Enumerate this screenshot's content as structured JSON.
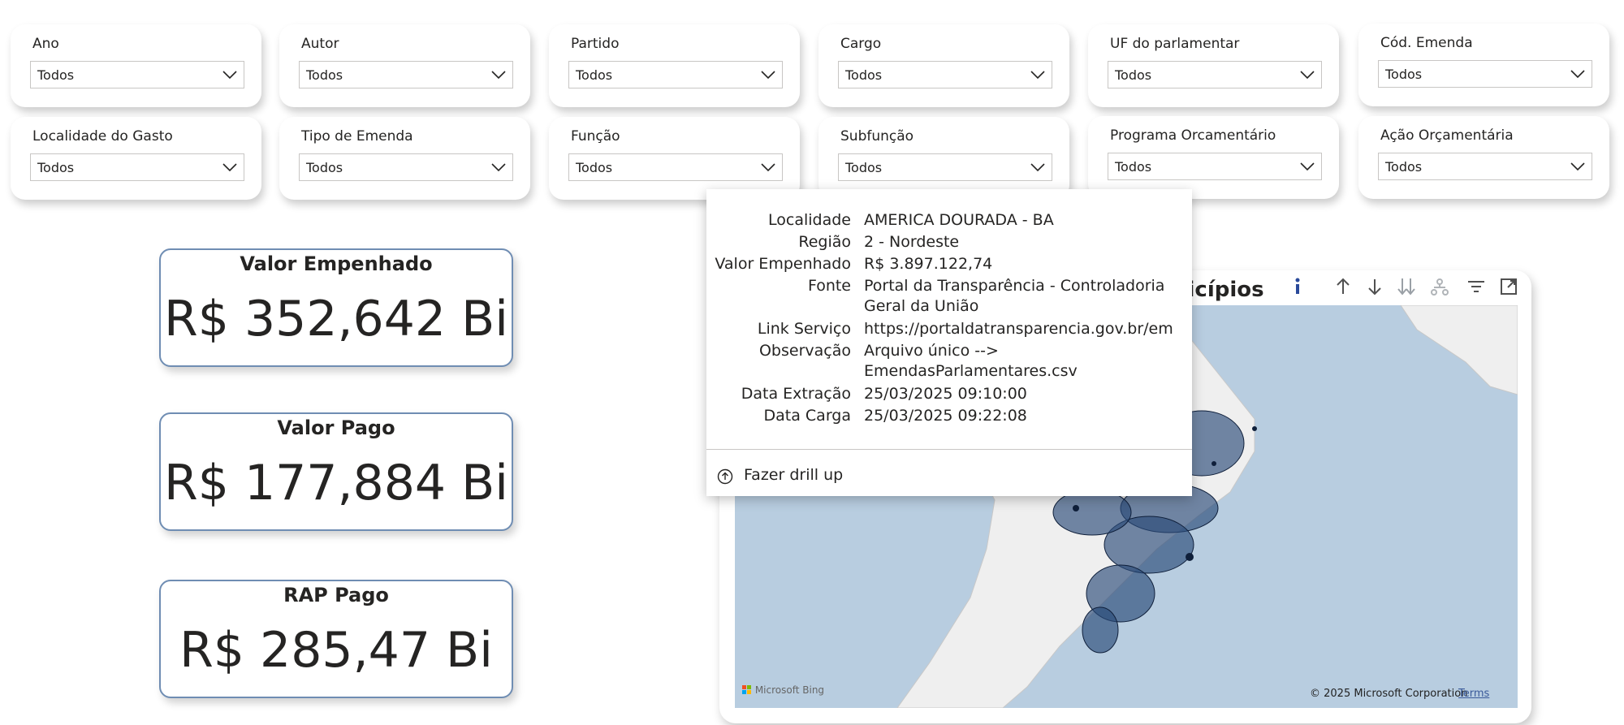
{
  "filters": [
    {
      "label": "Ano",
      "value": "Todos"
    },
    {
      "label": "Autor",
      "value": "Todos"
    },
    {
      "label": "Partido",
      "value": "Todos"
    },
    {
      "label": "Cargo",
      "value": "Todos"
    },
    {
      "label": "UF do parlamentar",
      "value": "Todos"
    },
    {
      "label": "Cód. Emenda",
      "value": "Todos"
    },
    {
      "label": "Localidade do Gasto",
      "value": "Todos"
    },
    {
      "label": "Tipo de Emenda",
      "value": "Todos"
    },
    {
      "label": "Função",
      "value": "Todos"
    },
    {
      "label": "Subfunção",
      "value": "Todos"
    },
    {
      "label": "Programa Orcamentário",
      "value": "Todos"
    },
    {
      "label": "Ação Orçamentária",
      "value": "Todos"
    }
  ],
  "cards": [
    {
      "title": "Valor Empenhado",
      "value": "R$ 352,642 Bi"
    },
    {
      "title": "Valor Pago",
      "value": "R$ 177,884 Bi"
    },
    {
      "title": "RAP Pago",
      "value": "R$ 285,47 Bi"
    }
  ],
  "map": {
    "title_visible": "nicípios",
    "info_icon": "i",
    "toolbar_icons": [
      "drill-up-icon",
      "drill-down-icon",
      "expand-next-level-icon",
      "hierarchy-icon",
      "filter-icon",
      "focus-mode-icon"
    ],
    "bing_label": "Microsoft Bing",
    "copyright": "© 2025 Microsoft Corporation",
    "terms": "Terms",
    "land_color": "#efefef",
    "water_color": "#b8cde0",
    "bubble_color": "#2a4a78"
  },
  "tooltip": {
    "rows": [
      {
        "key": "Localidade",
        "value": "AMERICA DOURADA - BA"
      },
      {
        "key": "Região",
        "value": "2 - Nordeste"
      },
      {
        "key": "Valor Empenhado",
        "value": "R$ 3.897.122,74"
      },
      {
        "key": "Fonte",
        "value": "Portal da Transparência - Controladoria Geral da União"
      },
      {
        "key": "Link Serviço",
        "value": "https://portaldatransparencia.gov.br/emen..."
      },
      {
        "key": "Observação",
        "value": "Arquivo único --> EmendasParlamentares.csv"
      },
      {
        "key": "Data Extração",
        "value": "25/03/2025 09:10:00"
      },
      {
        "key": "Data Carga",
        "value": "25/03/2025 09:22:08"
      }
    ],
    "drill_up_label": "Fazer drill up"
  }
}
